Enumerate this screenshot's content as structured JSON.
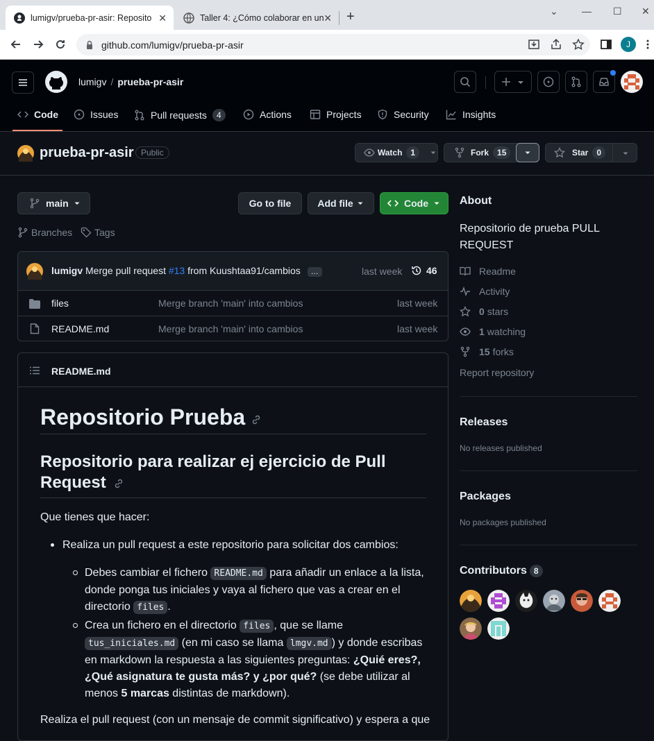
{
  "browser": {
    "tabs": [
      {
        "title": "lumigv/prueba-pr-asir: Reposito"
      },
      {
        "title": "Taller 4: ¿Cómo colaborar en un"
      }
    ],
    "url": "github.com/lumigv/prueba-pr-asir",
    "profile_initial": "J"
  },
  "header": {
    "owner": "lumigv",
    "separator": "/",
    "repo": "prueba-pr-asir"
  },
  "nav": {
    "code": "Code",
    "issues": "Issues",
    "pulls": "Pull requests",
    "pulls_count": "4",
    "actions": "Actions",
    "projects": "Projects",
    "security": "Security",
    "insights": "Insights"
  },
  "repo": {
    "name": "prueba-pr-asir",
    "visibility": "Public",
    "watch_label": "Watch",
    "watch_count": "1",
    "fork_label": "Fork",
    "fork_count": "15",
    "star_label": "Star",
    "star_count": "0"
  },
  "toolbar": {
    "branch": "main",
    "branches": "Branches",
    "tags": "Tags",
    "go_to_file": "Go to file",
    "add_file": "Add file",
    "code": "Code"
  },
  "commit": {
    "author": "lumigv",
    "message_prefix": "Merge pull request ",
    "pr_link": "#13",
    "message_suffix": " from Kuushtaa91/cambios",
    "time": "last week",
    "count": "46"
  },
  "files": [
    {
      "name": "files",
      "message": "Merge branch 'main' into cambios",
      "time": "last week",
      "type": "folder"
    },
    {
      "name": "README.md",
      "message": "Merge branch 'main' into cambios",
      "time": "last week",
      "type": "file"
    }
  ],
  "readme": {
    "header": "README.md",
    "h1": "Repositorio Prueba",
    "h2": "Repositorio para realizar ej ejercicio de Pull Request",
    "p1": "Que tienes que hacer:",
    "li1": "Realiza un pull request a este repositorio para solicitar dos cambios:",
    "sub1_a": "Debes cambiar el fichero ",
    "sub1_code1": "README.md",
    "sub1_b": " para añadir un enlace a la lista, donde ponga tus iniciales y vaya al fichero que vas a crear en el directorio ",
    "sub1_code2": "files",
    "sub1_c": ".",
    "sub2_a": "Crea un fichero en el directorio ",
    "sub2_code1": "files",
    "sub2_b": ", que se llame ",
    "sub2_code2": "tus_iniciales.md",
    "sub2_c": " (en mi caso se llama ",
    "sub2_code3": "lmgv.md",
    "sub2_d": ") y donde escribas en markdown la respuesta a las siguientes preguntas: ",
    "sub2_bold": "¿Quié eres?, ¿Qué asignatura te gusta más? y ¿por qué?",
    "sub2_e": " (se debe utilizar al menos ",
    "sub2_bold2": "5 marcas",
    "sub2_f": " distintas de markdown).",
    "p2": "Realiza el pull request (con un mensaje de commit significativo) y espera a que"
  },
  "about": {
    "title": "About",
    "description": "Repositorio de prueba PULL REQUEST",
    "readme": "Readme",
    "activity": "Activity",
    "stars_count": "0",
    "stars_label": "stars",
    "watching_count": "1",
    "watching_label": "watching",
    "forks_count": "15",
    "forks_label": "forks",
    "report": "Report repository"
  },
  "releases": {
    "title": "Releases",
    "empty": "No releases published"
  },
  "packages": {
    "title": "Packages",
    "empty": "No packages published"
  },
  "contributors": {
    "title": "Contributors",
    "count": "8"
  }
}
